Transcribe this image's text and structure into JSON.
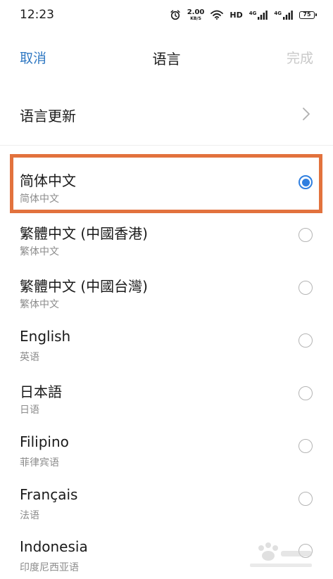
{
  "status_bar": {
    "time": "12:23",
    "net_speed_value": "2.00",
    "net_speed_unit": "KB/S",
    "hd_label": "HD",
    "sim1_tag": "4G",
    "sim2_tag": "4G",
    "battery": "75",
    "icons": [
      "alarm-icon",
      "wifi-icon",
      "signal-icon",
      "signal-icon",
      "battery-icon"
    ]
  },
  "header": {
    "cancel_label": "取消",
    "title": "语言",
    "done_label": "完成"
  },
  "update_row": {
    "label": "语言更新"
  },
  "languages": [
    {
      "name": "简体中文",
      "native": "简体中文",
      "selected": true
    },
    {
      "name": "繁體中文 (中國香港)",
      "native": "繁体中文",
      "selected": false
    },
    {
      "name": "繁體中文 (中國台灣)",
      "native": "繁体中文",
      "selected": false
    },
    {
      "name": "English",
      "native": "英语",
      "selected": false
    },
    {
      "name": "日本語",
      "native": "日语",
      "selected": false
    },
    {
      "name": "Filipino",
      "native": "菲律宾语",
      "selected": false
    },
    {
      "name": "Français",
      "native": "法语",
      "selected": false
    },
    {
      "name": "Indonesia",
      "native": "印度尼西亚语",
      "selected": false
    }
  ],
  "colors": {
    "accent": "#3179c3",
    "radio_selected": "#2f7fe0",
    "highlight": "#e2723d"
  }
}
